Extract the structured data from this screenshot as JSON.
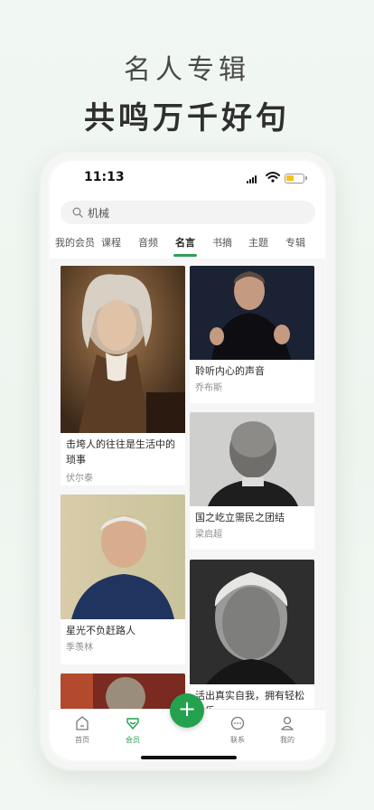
{
  "hero": {
    "title": "名人专辑",
    "subtitle": "共鸣万千好句"
  },
  "status_bar": {
    "time": "11:13"
  },
  "search": {
    "query": "机械"
  },
  "tabs": [
    {
      "label": "我的会员"
    },
    {
      "label": "课程"
    },
    {
      "label": "音频"
    },
    {
      "label": "名言",
      "active": true
    },
    {
      "label": "书摘"
    },
    {
      "label": "主题"
    },
    {
      "label": "专辑"
    }
  ],
  "cards": [
    {
      "title": "击垮人的往往是生活中的琐事",
      "author": "伏尔泰",
      "image": "portrait-voltaire"
    },
    {
      "title": "聆听内心的声音",
      "author": "乔布斯",
      "image": "photo-jobs"
    },
    {
      "title": "国之屹立需民之团结",
      "author": "梁启超",
      "image": "photo-liang-qichao"
    },
    {
      "title": "星光不负赶路人",
      "author": "季羡林",
      "image": "photo-ji-xianlin"
    },
    {
      "title": "活出真实自我，拥有轻松快乐",
      "author": "",
      "image": "photo-krishnamurti"
    }
  ],
  "bottom_nav": [
    {
      "label": "首页",
      "icon": "home-icon"
    },
    {
      "label": "会员",
      "icon": "member-heart-icon",
      "active": true
    },
    {
      "label": "",
      "icon": "plus-icon"
    },
    {
      "label": "联系",
      "icon": "chat-icon"
    },
    {
      "label": "我的",
      "icon": "profile-icon"
    }
  ],
  "colors": {
    "accent": "#23a14f",
    "background": "#eef5ef"
  }
}
